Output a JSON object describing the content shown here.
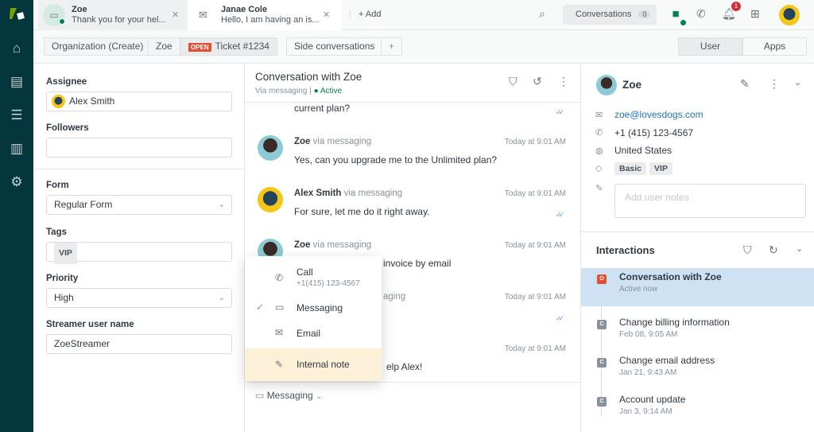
{
  "top_tabs": [
    {
      "name": "Zoe",
      "preview": "Thank you for your hel..."
    },
    {
      "name": "Janae Cole",
      "preview": "Hello, I am having an is..."
    }
  ],
  "add_tab": "+ Add",
  "conversations_label": "Conversations",
  "conversations_count": "0",
  "notification_count": "1",
  "breadcrumbs": [
    "Organization (Create)",
    "Zoe"
  ],
  "ticket_status": "OPEN",
  "ticket_label": "Ticket #1234",
  "side_conversations": "Side conversations",
  "side_add": "+",
  "right_tabs": [
    "User",
    "Apps"
  ],
  "fields": {
    "assignee_label": "Assignee",
    "assignee": "Alex Smith",
    "followers_label": "Followers",
    "form_label": "Form",
    "form": "Regular Form",
    "tags_label": "Tags",
    "tag": "VIP",
    "priority_label": "Priority",
    "priority": "High",
    "streamer_label": "Streamer user name",
    "streamer": "ZoeStreamer"
  },
  "conversation": {
    "title": "Conversation with Zoe",
    "via": "Via messaging",
    "status": "Active",
    "status_color": "#038153"
  },
  "messages": [
    {
      "text": "current plan?"
    },
    {
      "name": "Zoe",
      "via": "via messaging",
      "time": "Today at 9:01 AM",
      "text": "Yes, can you upgrade me to the Unlimited plan?"
    },
    {
      "name": "Alex Smith",
      "via": "via messaging",
      "time": "Today at 9:01 AM",
      "text": "For sure, let me do it right away."
    },
    {
      "name": "Zoe",
      "via": "via messaging",
      "time": "Today at 9:01 AM",
      "text": "invoice by email"
    },
    {
      "via": "aging",
      "time": "Today at 9:01 AM"
    },
    {
      "time": "Today at 9:01 AM",
      "text": "elp Alex!"
    }
  ],
  "channel_menu": {
    "call": "Call",
    "call_number": "+1(415) 123-4567",
    "messaging": "Messaging",
    "email": "Email",
    "internal_note": "Internal note",
    "highlight_color": "#fdf0d8"
  },
  "composer_channel": "Messaging",
  "user": {
    "name": "Zoe",
    "email": "zoe@lovesdogs.com",
    "phone": "+1 (415) 123-4567",
    "country": "United States",
    "tags": [
      "Basic",
      "VIP"
    ],
    "notes_placeholder": "Add user notes"
  },
  "interactions": {
    "title": "Interactions",
    "items": [
      {
        "badge": "O",
        "title": "Conversation with Zoe",
        "sub": "Active now",
        "active": true
      },
      {
        "badge": "C",
        "title": "Change billing information",
        "sub": "Feb 08, 9:05 AM"
      },
      {
        "badge": "C",
        "title": "Change email address",
        "sub": "Jan 21, 9:43 AM"
      },
      {
        "badge": "C",
        "title": "Account update",
        "sub": "Jan 3, 9:14 AM"
      }
    ]
  },
  "colors": {
    "nav": "#03363d",
    "brand_green": "#78a300",
    "open_badge": "#e34f32",
    "active_row": "#cfe2f3"
  }
}
